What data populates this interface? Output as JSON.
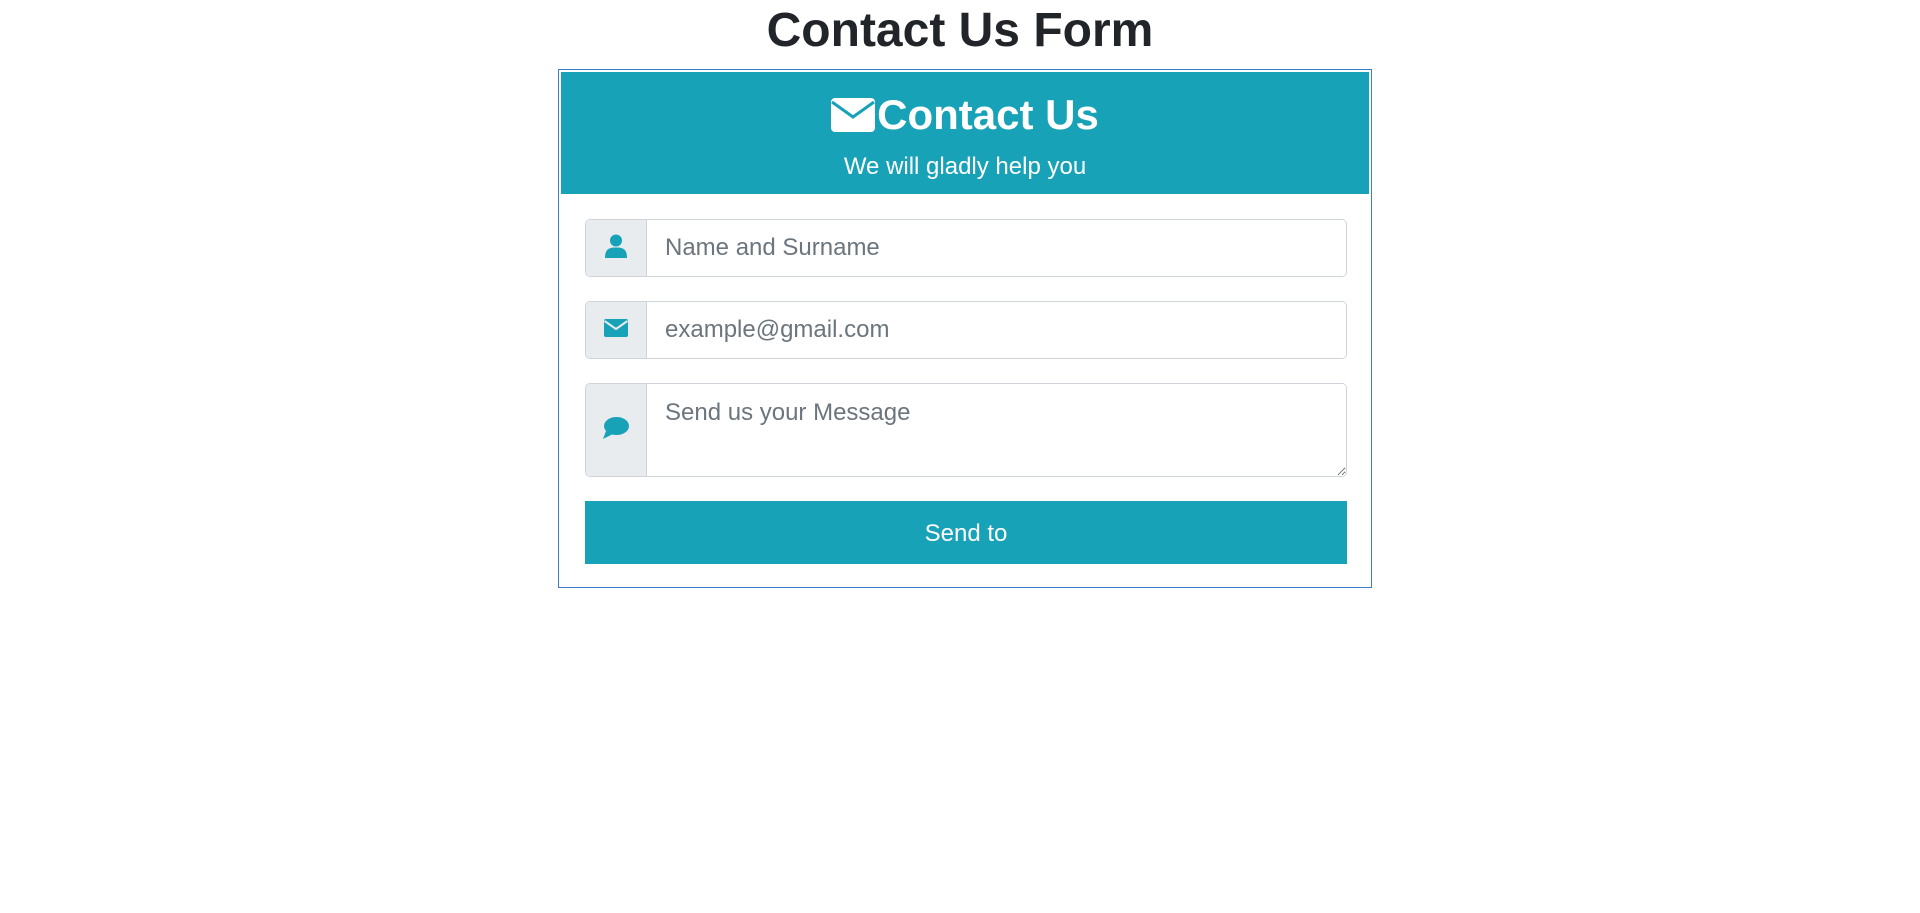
{
  "page": {
    "title": "Contact Us Form"
  },
  "card": {
    "header_title": "Contact Us",
    "header_subtitle": "We will gladly help you",
    "header_icon": "envelope-icon",
    "accent_color": "#17a2b8"
  },
  "form": {
    "name": {
      "placeholder": "Name and Surname",
      "value": "",
      "icon": "user-icon"
    },
    "email": {
      "placeholder": "example@gmail.com",
      "value": "",
      "icon": "envelope-icon"
    },
    "message": {
      "placeholder": "Send us your Message",
      "value": "",
      "icon": "speech-bubble-icon"
    },
    "submit_label": "Send to"
  }
}
